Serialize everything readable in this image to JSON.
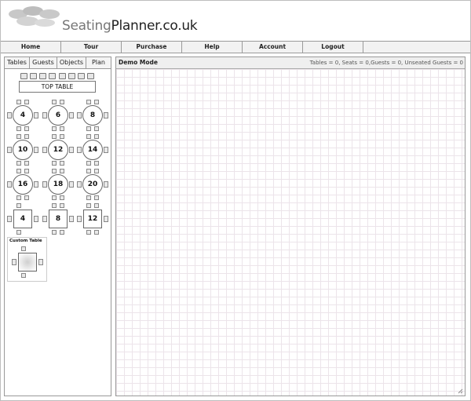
{
  "app": {
    "logo_light": "Seating",
    "logo_dark": "Planner.co.uk"
  },
  "nav": [
    "Home",
    "Tour",
    "Purchase",
    "Help",
    "Account",
    "Logout"
  ],
  "tabs": [
    "Tables",
    "Guests",
    "Objects",
    "Plan"
  ],
  "palette": {
    "top_table_label": "TOP TABLE",
    "round_tables": [
      "4",
      "6",
      "8",
      "10",
      "12",
      "14",
      "16",
      "18",
      "20"
    ],
    "square_tables": [
      "4",
      "8",
      "12"
    ],
    "custom_label": "Custom Table"
  },
  "main": {
    "mode": "Demo Mode",
    "stats": "Tables = 0, Seats = 0,Guests = 0, Unseated Guests = 0"
  },
  "colors": {
    "grid": "#ece4ea",
    "panel_border": "#999999",
    "logo_mark": "#c4c4c4"
  },
  "icons": [
    "resize-grip-icon"
  ]
}
